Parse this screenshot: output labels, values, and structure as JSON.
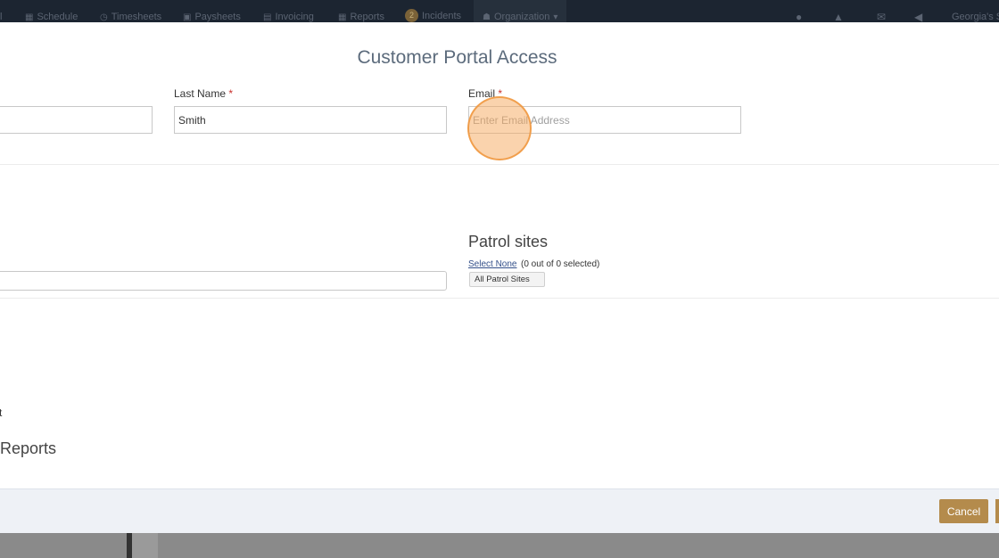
{
  "navbar": {
    "items": [
      {
        "label": "l",
        "icon": ""
      },
      {
        "label": "Schedule",
        "icon": "calendar-icon"
      },
      {
        "label": "Timesheets",
        "icon": "clock-icon"
      },
      {
        "label": "Paysheets",
        "icon": "money-icon"
      },
      {
        "label": "Invoicing",
        "icon": "invoice-icon"
      },
      {
        "label": "Reports",
        "icon": "table-icon"
      },
      {
        "label": "Incidents",
        "icon": "",
        "badge": "2"
      },
      {
        "label": "Organization",
        "icon": "users-icon"
      }
    ],
    "user_label": "Georgia's S"
  },
  "modal": {
    "title": "Customer Portal Access",
    "last_name": {
      "label": "Last Name",
      "value": "Smith"
    },
    "email": {
      "label": "Email",
      "placeholder": "Enter Email Address",
      "value": ""
    },
    "patrol_sites": {
      "heading": "Patrol sites",
      "select_none": "Select None",
      "selection_count": "(0 out of 0 selected)",
      "dropdown_label": "All Patrol Sites"
    },
    "cut_off_text_1": "t",
    "cut_off_heading": "Reports",
    "footer": {
      "cancel_label": "Cancel"
    }
  },
  "colors": {
    "accent": "#b48b4c",
    "navbar_bg": "#1c2531",
    "footer_bg": "#eef1f6",
    "title_color": "#5c6b7c",
    "click_indicator": "#f5a85c"
  }
}
